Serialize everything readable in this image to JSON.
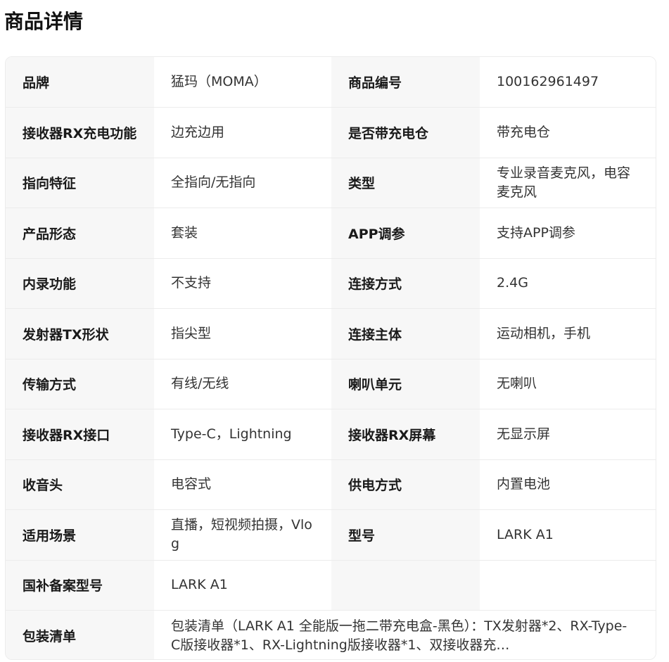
{
  "page": {
    "title": "商品详情"
  },
  "specs": {
    "rows": [
      {
        "l1": "品牌",
        "v1": "猛玛（MOMA）",
        "l2": "商品编号",
        "v2": "100162961497"
      },
      {
        "l1": "接收器RX充电功能",
        "v1": "边充边用",
        "l2": "是否带充电仓",
        "v2": "带充电仓"
      },
      {
        "l1": "指向特征",
        "v1": "全指向/无指向",
        "l2": "类型",
        "v2": "专业录音麦克风，电容麦克风"
      },
      {
        "l1": "产品形态",
        "v1": "套装",
        "l2": "APP调参",
        "v2": "支持APP调参"
      },
      {
        "l1": "内录功能",
        "v1": "不支持",
        "l2": "连接方式",
        "v2": "2.4G"
      },
      {
        "l1": "发射器TX形状",
        "v1": "指尖型",
        "l2": "连接主体",
        "v2": "运动相机，手机"
      },
      {
        "l1": "传输方式",
        "v1": "有线/无线",
        "l2": "喇叭单元",
        "v2": "无喇叭"
      },
      {
        "l1": "接收器RX接口",
        "v1": "Type-C，Lightning",
        "l2": "接收器RX屏幕",
        "v2": "无显示屏"
      },
      {
        "l1": "收音头",
        "v1": "电容式",
        "l2": "供电方式",
        "v2": "内置电池"
      },
      {
        "l1": "适用场景",
        "v1": "直播，短视频拍摄，Vlog",
        "l2": "型号",
        "v2": "LARK A1"
      },
      {
        "l1": "国补备案型号",
        "v1": "LARK A1",
        "l2": "",
        "v2": ""
      }
    ],
    "package": {
      "label": "包装清单",
      "value": "包装清单（LARK A1 全能版一拖二带充电盒-黑色）：TX发射器*2、RX-Type-C版接收器*1、RX-Lightning版接收器*1、双接收器充…"
    }
  }
}
